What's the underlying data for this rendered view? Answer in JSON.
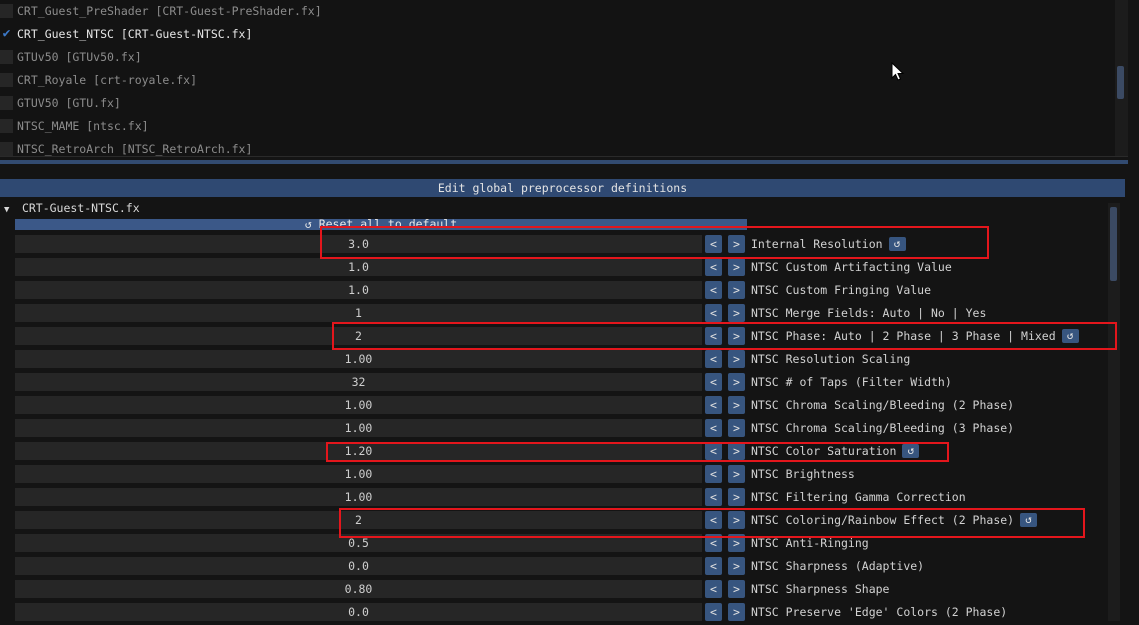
{
  "effects": [
    {
      "label": "CRT_Guest_PreShader [CRT-Guest-PreShader.fx]",
      "enabled": false
    },
    {
      "label": "CRT_Guest_NTSC [CRT-Guest-NTSC.fx]",
      "enabled": true
    },
    {
      "label": "GTUv50 [GTUv50.fx]",
      "enabled": false
    },
    {
      "label": "CRT_Royale [crt-royale.fx]",
      "enabled": false
    },
    {
      "label": "GTUV50 [GTU.fx]",
      "enabled": false
    },
    {
      "label": "NTSC_MAME [ntsc.fx]",
      "enabled": false
    },
    {
      "label": "NTSC_RetroArch [NTSC_RetroArch.fx]",
      "enabled": false
    }
  ],
  "checkmark_glyph": "✔",
  "section": {
    "title": "Edit global preprocessor definitions",
    "node": "CRT-Guest-NTSC.fx",
    "node_arrow": "▼",
    "reset_all_label": "Reset all to default",
    "reset_glyph": "↺"
  },
  "stepper": {
    "dec": "<",
    "inc": ">"
  },
  "definitions": [
    {
      "value": "3.0",
      "label": "Internal Resolution",
      "modified": true
    },
    {
      "value": "1.0",
      "label": "NTSC Custom Artifacting Value",
      "modified": false
    },
    {
      "value": "1.0",
      "label": "NTSC Custom Fringing Value",
      "modified": false
    },
    {
      "value": "1",
      "label": "NTSC Merge Fields: Auto | No | Yes",
      "modified": false
    },
    {
      "value": "2",
      "label": "NTSC Phase: Auto | 2 Phase | 3 Phase | Mixed",
      "modified": true
    },
    {
      "value": "1.00",
      "label": "NTSC Resolution Scaling",
      "modified": false
    },
    {
      "value": "32",
      "label": "NTSC # of Taps (Filter Width)",
      "modified": false
    },
    {
      "value": "1.00",
      "label": "NTSC Chroma Scaling/Bleeding (2 Phase)",
      "modified": false
    },
    {
      "value": "1.00",
      "label": "NTSC Chroma Scaling/Bleeding (3 Phase)",
      "modified": false
    },
    {
      "value": "1.20",
      "label": "NTSC Color Saturation",
      "modified": true
    },
    {
      "value": "1.00",
      "label": "NTSC Brightness",
      "modified": false
    },
    {
      "value": "1.00",
      "label": "NTSC Filtering Gamma Correction",
      "modified": false
    },
    {
      "value": "2",
      "label": "NTSC Coloring/Rainbow Effect (2 Phase)",
      "modified": true
    },
    {
      "value": "0.5",
      "label": "NTSC Anti-Ringing",
      "modified": false
    },
    {
      "value": "0.0",
      "label": "NTSC Sharpness (Adaptive)",
      "modified": false
    },
    {
      "value": "0.80",
      "label": "NTSC Sharpness Shape",
      "modified": false
    },
    {
      "value": "0.0",
      "label": "NTSC Preserve 'Edge' Colors (2 Phase)",
      "modified": false
    }
  ],
  "colors": {
    "accent": "#37557f",
    "header": "#2f4972",
    "highlight": "#e4161c"
  }
}
